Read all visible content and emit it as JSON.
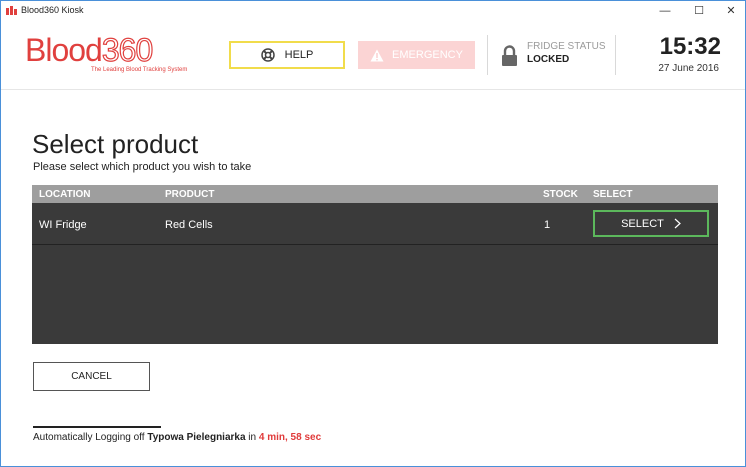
{
  "window": {
    "title": "Blood360 Kiosk",
    "controls": {
      "minimize": "—",
      "maximize": "☐",
      "close": "✕"
    }
  },
  "header": {
    "logo": {
      "text_word": "Blood",
      "text_num": "360",
      "tagline": "The Leading Blood Tracking System"
    },
    "help_label": "HELP",
    "emergency_label": "EMERGENCY",
    "fridge_status_label": "FRIDGE STATUS",
    "fridge_status_value": "LOCKED",
    "clock": "15:32",
    "date": "27 June 2016"
  },
  "main": {
    "title": "Select product",
    "subtitle": "Please select which product you wish to take",
    "table": {
      "columns": [
        "LOCATION",
        "PRODUCT",
        "STOCK",
        "SELECT"
      ],
      "rows": [
        {
          "location": "WI Fridge",
          "product": "Red Cells",
          "stock": "1",
          "select_label": "SELECT"
        }
      ]
    },
    "cancel_label": "CANCEL"
  },
  "footer": {
    "prefix": "Automatically Logging off ",
    "user": "Typowa Pielegniarka",
    "middle": " in ",
    "time": "4 min, 58 sec"
  },
  "colors": {
    "brand_red": "#e0403e",
    "help_border": "#f1dc4b",
    "emergency_bg": "#fbd4d4",
    "select_border": "#5cb85c",
    "table_bg": "#3a3a3a",
    "table_header_bg": "#9e9e9e",
    "countdown": "#e03a3a"
  },
  "icons": {
    "app": "blood360-app-icon",
    "help": "lifebuoy-icon",
    "emergency": "warning-triangle-icon",
    "fridge": "padlock-icon",
    "select": "chevron-right-icon"
  }
}
